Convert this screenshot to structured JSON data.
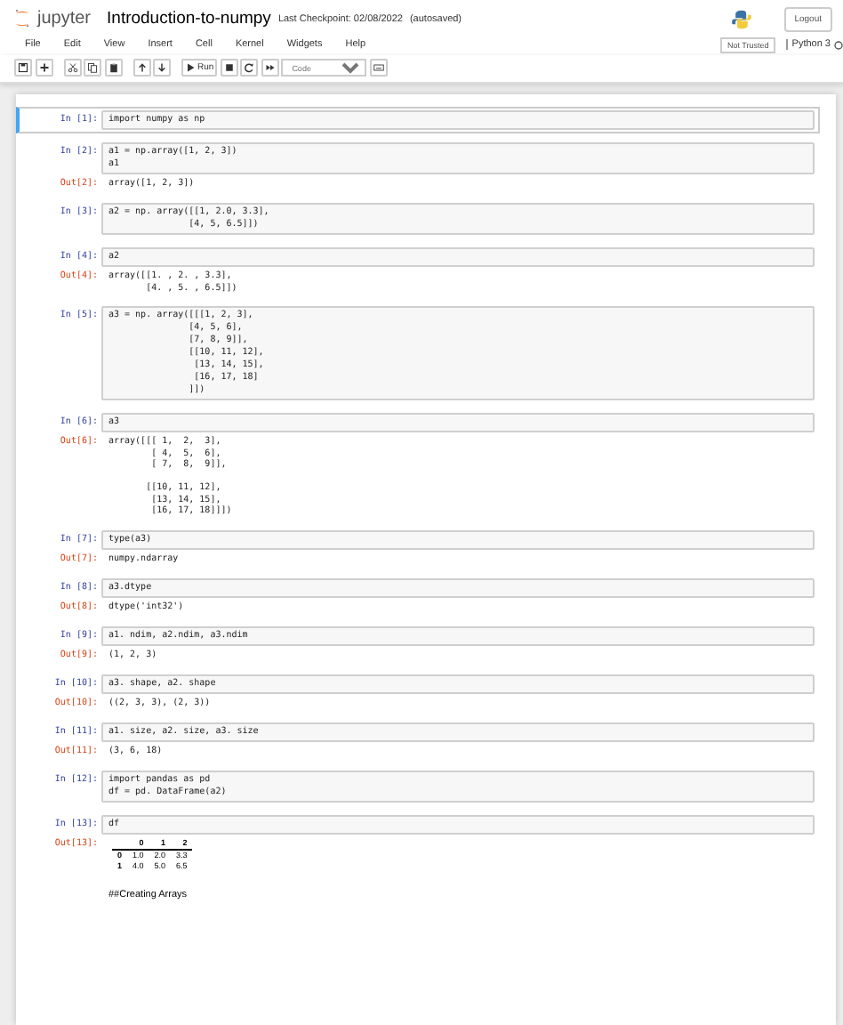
{
  "header": {
    "logo_text": "jupyter",
    "title": "Introduction-to-numpy",
    "checkpoint": "Last Checkpoint: 02/08/2022",
    "autosave": "(autosaved)",
    "logout": "Logout"
  },
  "menu": [
    "File",
    "Edit",
    "View",
    "Insert",
    "Cell",
    "Kernel",
    "Widgets",
    "Help"
  ],
  "trust": "Not Trusted",
  "kernel": "Python 3",
  "toolbar": {
    "run_label": "Run",
    "cell_type": "Code"
  },
  "cells": [
    {
      "kind": "code",
      "selected": true,
      "prompt": "In [1]:",
      "source": "import numpy as np"
    },
    {
      "kind": "code",
      "selected": false,
      "prompt": "In [2]:",
      "source": "a1 = np.array([1, 2, 3])\na1",
      "output": {
        "kind": "text",
        "prompt": "Out[2]:",
        "text": "array([1, 2, 3])"
      }
    },
    {
      "kind": "code",
      "selected": false,
      "prompt": "In [3]:",
      "source": "a2 = np. array([[1, 2.0, 3.3],\n               [4, 5, 6.5]])"
    },
    {
      "kind": "code",
      "selected": false,
      "prompt": "In [4]:",
      "source": "a2",
      "output": {
        "kind": "text",
        "prompt": "Out[4]:",
        "text": "array([[1. , 2. , 3.3],\n       [4. , 5. , 6.5]])"
      }
    },
    {
      "kind": "code",
      "selected": false,
      "prompt": "In [5]:",
      "source": "a3 = np. array([[[1, 2, 3],\n               [4, 5, 6],\n               [7, 8, 9]],\n               [[10, 11, 12],\n                [13, 14, 15],\n                [16, 17, 18]\n               ]])"
    },
    {
      "kind": "code",
      "selected": false,
      "prompt": "In [6]:",
      "source": "a3",
      "output": {
        "kind": "text",
        "prompt": "Out[6]:",
        "text": "array([[[ 1,  2,  3],\n        [ 4,  5,  6],\n        [ 7,  8,  9]],\n\n       [[10, 11, 12],\n        [13, 14, 15],\n        [16, 17, 18]]])"
      }
    },
    {
      "kind": "code",
      "selected": false,
      "prompt": "In [7]:",
      "source": "type(a3)",
      "output": {
        "kind": "text",
        "prompt": "Out[7]:",
        "text": "numpy.ndarray"
      }
    },
    {
      "kind": "code",
      "selected": false,
      "prompt": "In [8]:",
      "source": "a3.dtype",
      "output": {
        "kind": "text",
        "prompt": "Out[8]:",
        "text": "dtype('int32')"
      }
    },
    {
      "kind": "code",
      "selected": false,
      "prompt": "In [9]:",
      "source": "a1. ndim, a2.ndim, a3.ndim",
      "output": {
        "kind": "text",
        "prompt": "Out[9]:",
        "text": "(1, 2, 3)"
      }
    },
    {
      "kind": "code",
      "selected": false,
      "prompt": "In [10]:",
      "source": "a3. shape, a2. shape",
      "output": {
        "kind": "text",
        "prompt": "Out[10]:",
        "text": "((2, 3, 3), (2, 3))"
      }
    },
    {
      "kind": "code",
      "selected": false,
      "prompt": "In [11]:",
      "source": "a1. size, a2. size, a3. size",
      "output": {
        "kind": "text",
        "prompt": "Out[11]:",
        "text": "(3, 6, 18)"
      }
    },
    {
      "kind": "code",
      "selected": false,
      "prompt": "In [12]:",
      "source": "import pandas as pd\ndf = pd. DataFrame(a2)"
    },
    {
      "kind": "code",
      "selected": false,
      "prompt": "In [13]:",
      "source": "df",
      "output": {
        "kind": "table",
        "prompt": "Out[13]:",
        "columns": [
          "0",
          "1",
          "2"
        ],
        "rows": [
          {
            "index": "0",
            "values": [
              "1.0",
              "2.0",
              "3.3"
            ]
          },
          {
            "index": "1",
            "values": [
              "4.0",
              "5.0",
              "6.5"
            ]
          }
        ]
      }
    },
    {
      "kind": "markdown",
      "text": "##Creating Arrays"
    }
  ]
}
